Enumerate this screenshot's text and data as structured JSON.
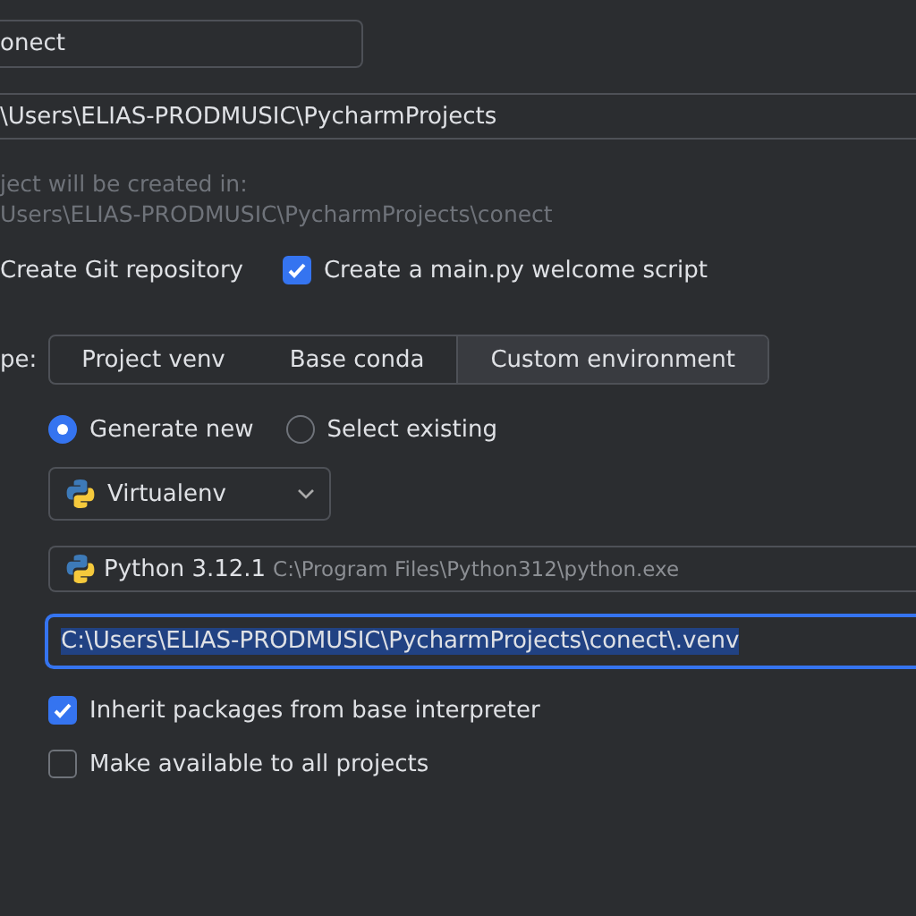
{
  "name_field": {
    "value": "onect"
  },
  "location_field": {
    "value": "\\Users\\ELIAS-PRODMUSIC\\PycharmProjects"
  },
  "location_hint": [
    "ject will be created in:",
    "Users\\ELIAS-PRODMUSIC\\PycharmProjects\\conect"
  ],
  "options": [
    {
      "label": "Create Git repository"
    },
    {
      "label": "Create a main.py welcome script",
      "checked": true
    }
  ],
  "type_label": "pe:",
  "env_tabs": [
    {
      "label": "Project venv",
      "selected": false
    },
    {
      "label": "Base conda",
      "selected": false
    },
    {
      "label": "Custom environment",
      "selected": true
    }
  ],
  "env_modes": [
    {
      "label": "Generate new",
      "selected": true
    },
    {
      "label": "Select existing",
      "selected": false
    }
  ],
  "env_type": {
    "value": "Virtualenv"
  },
  "base_interpreter": {
    "name": "Python 3.12.1",
    "path": "C:\\Program Files\\Python312\\python.exe"
  },
  "venv_location": {
    "value": "C:\\Users\\ELIAS-PRODMUSIC\\PycharmProjects\\conect\\.venv",
    "focused": true,
    "text_selected": true
  },
  "venv_options": [
    {
      "label": "Inherit packages from base interpreter",
      "checked": true
    },
    {
      "label": "Make available to all projects",
      "checked": false
    }
  ]
}
